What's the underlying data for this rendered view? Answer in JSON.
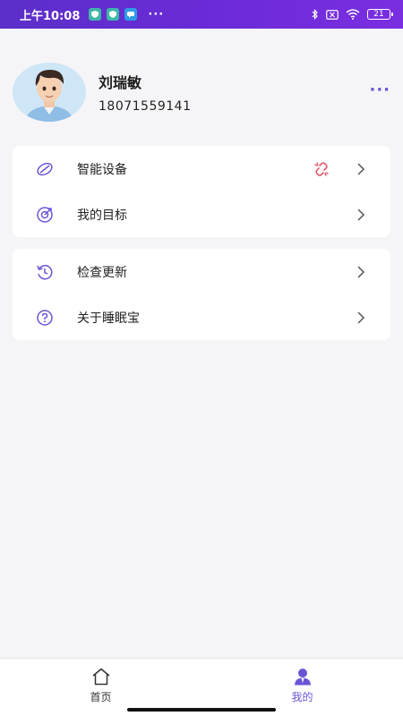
{
  "status_bar": {
    "time": "上午10:08",
    "dots": "···",
    "battery": "21",
    "icons": [
      "shield-app-icon",
      "shield-app-icon",
      "chat-app-icon",
      "bluetooth-icon",
      "mute-icon",
      "wifi-icon",
      "battery-icon"
    ]
  },
  "profile": {
    "name": "刘瑞敏",
    "phone": "18071559141",
    "more": "···"
  },
  "menu": {
    "group1": [
      {
        "label": "智能设备",
        "icon": "leaf-device-icon",
        "badge_icon": "unlink-icon"
      },
      {
        "label": "我的目标",
        "icon": "target-icon"
      }
    ],
    "group2": [
      {
        "label": "检查更新",
        "icon": "history-icon"
      },
      {
        "label": "关于睡眠宝",
        "icon": "help-icon"
      }
    ]
  },
  "bottom_nav": [
    {
      "label": "首页",
      "icon": "home-icon",
      "active": false
    },
    {
      "label": "我的",
      "icon": "user-icon",
      "active": true
    }
  ],
  "colors": {
    "status_bar": "#6a2bd6",
    "accent": "#6a55d6",
    "unlink": "#e05a6e",
    "background": "#f5f5f7"
  }
}
